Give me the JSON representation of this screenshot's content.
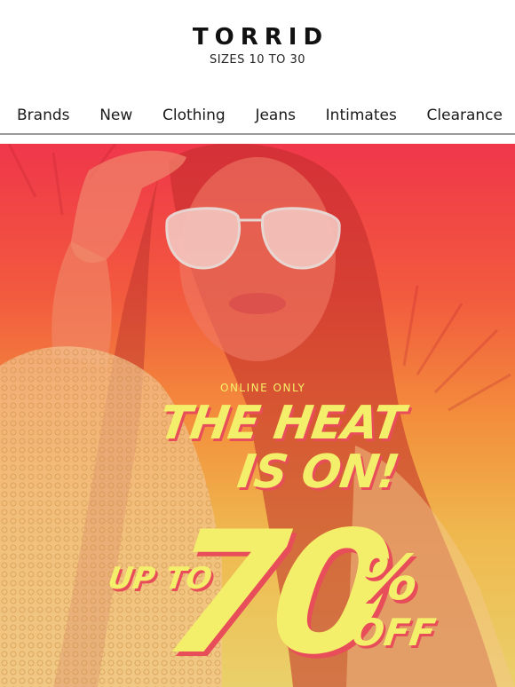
{
  "header": {
    "brand": "TORRID",
    "tagline": "SIZES 10 TO 30"
  },
  "nav": {
    "items": [
      "Brands",
      "New",
      "Clothing",
      "Jeans",
      "Intimates",
      "Clearance"
    ]
  },
  "hero": {
    "eyebrow": "ONLINE ONLY",
    "headline_line1": "THE HEAT",
    "headline_line2": "IS ON!",
    "up_to": "UP TO",
    "discount": "70",
    "percent": "%",
    "off": "OFF",
    "colors": {
      "text": "#f4ef6a",
      "shadow": "#e84d5a",
      "gradient_top": "#f0374a",
      "gradient_bottom": "#ead06a"
    }
  }
}
